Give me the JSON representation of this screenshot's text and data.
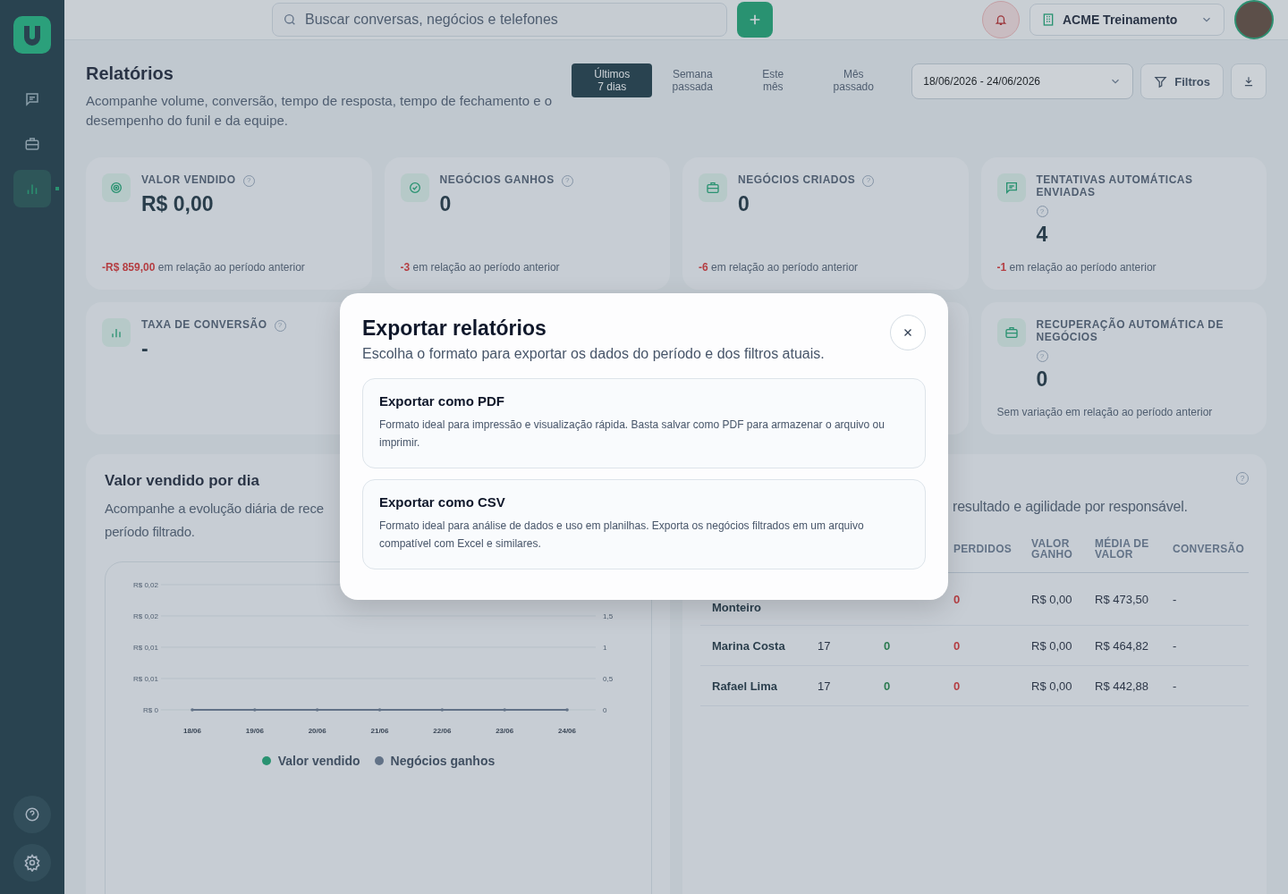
{
  "topbar": {
    "search_placeholder": "Buscar conversas, negócios e telefones",
    "organization": "ACME Treinamento"
  },
  "header": {
    "title": "Relatórios",
    "subtitle": "Acompanhe volume, conversão, tempo de resposta, tempo de fechamento e o desempenho do funil e da equipe.",
    "periods": [
      {
        "label": "Últimos 7 dias",
        "selected": true
      },
      {
        "label": "Semana passada",
        "selected": false
      },
      {
        "label": "Este mês",
        "selected": false
      },
      {
        "label": "Mês passado",
        "selected": false
      }
    ],
    "date_range": "18/06/2026 - 24/06/2026",
    "filters_button": "Filtros"
  },
  "metrics_row_1": [
    {
      "title": "VALOR VENDIDO",
      "help": "?",
      "value": "R$ 0,00",
      "delta": "-R$ 859,00",
      "delta_text": "em relação ao período anterior"
    },
    {
      "title": "NEGÓCIOS GANHOS",
      "help": "?",
      "value": "0",
      "delta": "-3",
      "delta_text": "em relação ao período anterior"
    },
    {
      "title": "NEGÓCIOS CRIADOS",
      "help": "?",
      "value": "0",
      "delta": "-6",
      "delta_text": "em relação ao período anterior"
    },
    {
      "title": "TENTATIVAS AUTOMÁTICAS ENVIADAS",
      "help": "?",
      "value": "4",
      "delta": "-1",
      "delta_text": "em relação ao período anterior"
    }
  ],
  "metrics_row_2": [
    {
      "title": "TAXA DE CONVERSÃO",
      "help": "?",
      "value": "-"
    },
    {
      "title": "RECUPERAÇÃO AUTOMÁTICA DE NEGÓCIOS",
      "help": "?",
      "value": "0",
      "delta_text": "Sem variação em relação ao período anterior"
    }
  ],
  "sales_panel": {
    "title": "Valor vendido por dia",
    "subtitle": "Acompanhe a evolução diária de rece",
    "subtitle_2": "período filtrado.",
    "chart_data": {
      "type": "line",
      "categories": [
        "18/06",
        "19/06",
        "20/06",
        "21/06",
        "22/06",
        "23/06",
        "24/06"
      ],
      "grid": true,
      "series": [
        {
          "name": "Valor vendido",
          "color": "#10a36b",
          "values": [
            null,
            null,
            null,
            null,
            null,
            null,
            null
          ]
        },
        {
          "name": "Negócios ganhos",
          "color": "#64748b",
          "values": [
            0,
            0,
            0,
            0,
            0,
            0,
            0
          ]
        }
      ],
      "ylim": [
        0,
        2
      ],
      "yticks": [
        {
          "value": 1.5,
          "label": "1,5"
        },
        1,
        {
          "value": 0.5,
          "label": "0,5"
        },
        0
      ]
    },
    "left_axis_labels": [
      "R$ 0,02",
      "R$ 0,02",
      "R$ 0,01",
      "R$ 0,01",
      "R$ 0"
    ]
  },
  "team_panel": {
    "help": "?",
    "subtitle": "resultado e agilidade por responsável.",
    "columns": [
      "PERDIDOS",
      "VALOR GANHO",
      "MÉDIA DE VALOR",
      "CONVERSÃO"
    ],
    "rows": [
      {
        "name": "Monteiro",
        "lost": "0",
        "value": "R$ 0,00",
        "average": "R$ 473,50",
        "conversion": "-"
      },
      {
        "name": "Marina Costa",
        "count": "17",
        "won": "0",
        "lost": "0",
        "value": "R$ 0,00",
        "average": "R$ 464,82",
        "conversion": "-"
      },
      {
        "name": "Rafael Lima",
        "count": "17",
        "won": "0",
        "lost": "0",
        "value": "R$ 0,00",
        "average": "R$ 442,88",
        "conversion": "-"
      }
    ]
  },
  "modal": {
    "title": "Exportar relatórios",
    "subtitle": "Escolha o formato para exportar os dados do período e dos filtros atuais.",
    "options": [
      {
        "title": "Exportar como PDF",
        "description": "Formato ideal para impressão e visualização rápida. Basta salvar como PDF para armazenar o arquivo ou imprimir."
      },
      {
        "title": "Exportar como CSV",
        "description": "Formato ideal para análise de dados e uso em planilhas. Exporta os negócios filtrados em um arquivo compatível com Excel e similares."
      }
    ]
  }
}
